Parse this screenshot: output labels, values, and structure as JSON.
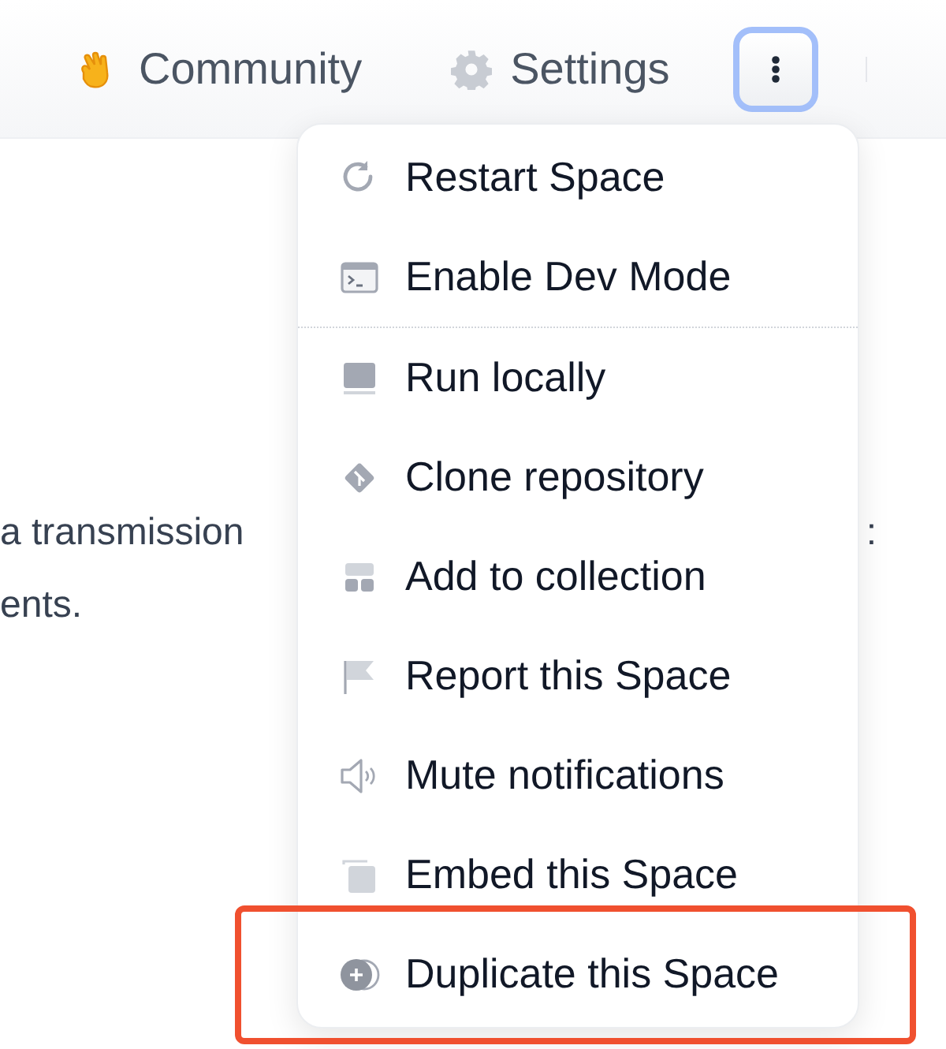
{
  "header": {
    "links": [
      {
        "label": "Community",
        "kind": "hand"
      },
      {
        "label": "Settings",
        "kind": "gear"
      }
    ],
    "more_button": {
      "focused": true
    }
  },
  "background_text": {
    "left_lines": [
      "a transmission",
      "ents."
    ],
    "right_mark": ":"
  },
  "menu": {
    "groups": [
      {
        "items": [
          {
            "label": "Restart Space",
            "kind": "restart",
            "highlighted": false
          },
          {
            "label": "Enable Dev Mode",
            "kind": "terminal",
            "highlighted": false
          }
        ]
      },
      {
        "items": [
          {
            "label": "Run locally",
            "kind": "monitor",
            "highlighted": false
          },
          {
            "label": "Clone repository",
            "kind": "git",
            "highlighted": false
          },
          {
            "label": "Add to collection",
            "kind": "collection",
            "highlighted": false
          },
          {
            "label": "Report this Space",
            "kind": "flag",
            "highlighted": false
          },
          {
            "label": "Mute notifications",
            "kind": "speaker",
            "highlighted": false
          },
          {
            "label": "Embed this Space",
            "kind": "embed",
            "highlighted": false
          },
          {
            "label": "Duplicate this Space",
            "kind": "duplicate",
            "highlighted": true
          }
        ]
      }
    ]
  }
}
